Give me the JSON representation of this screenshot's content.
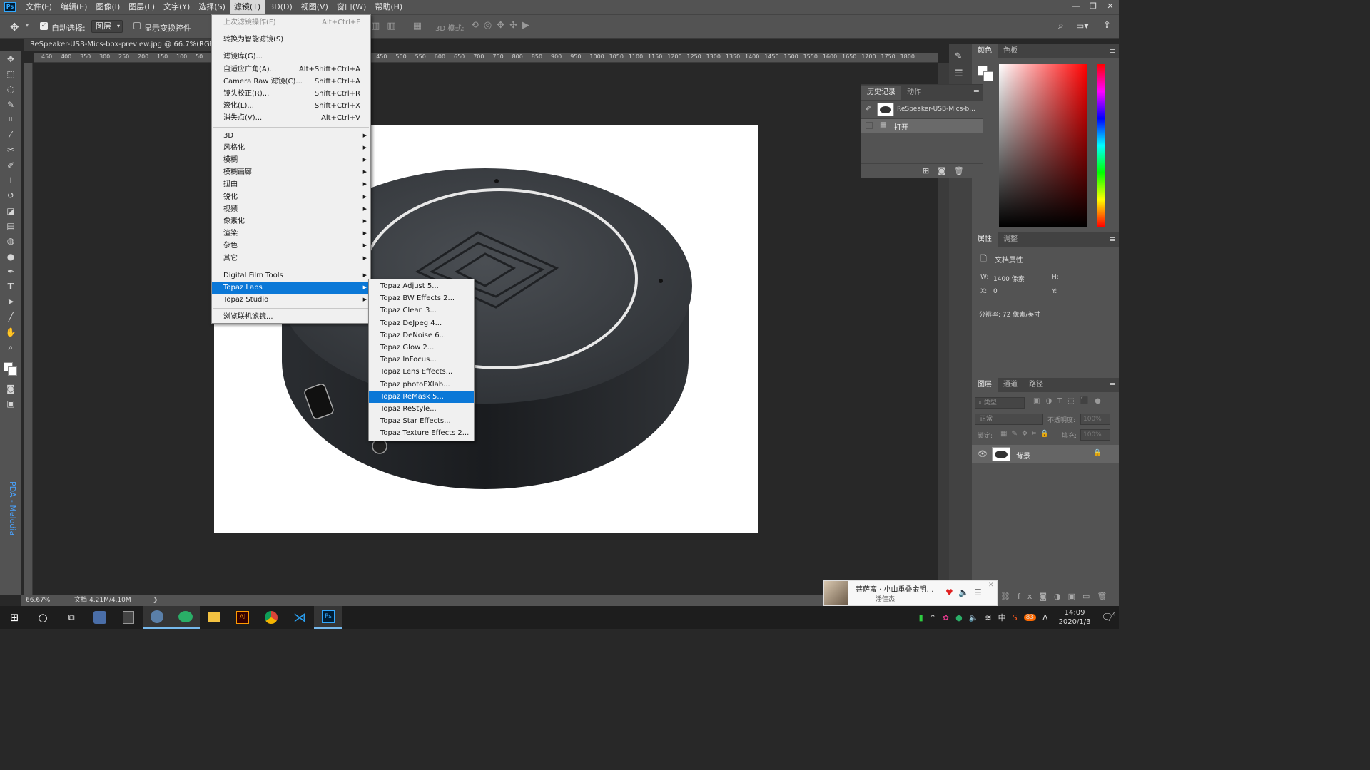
{
  "menubar": {
    "logo": "Ps",
    "items": [
      "文件(F)",
      "编辑(E)",
      "图像(I)",
      "图层(L)",
      "文字(Y)",
      "选择(S)",
      "滤镜(T)",
      "3D(D)",
      "视图(V)",
      "窗口(W)",
      "帮助(H)"
    ],
    "active_index": 6,
    "window_controls": [
      "—",
      "❐",
      "✕"
    ]
  },
  "options": {
    "auto_select_label": "自动选择:",
    "auto_select_checked": true,
    "auto_select_value": "图层",
    "show_transform_label": "显示变换控件",
    "mode_3d_label": "3D 模式:"
  },
  "document": {
    "tab_title": "ReSpeaker-USB-Mics-box-preview.jpg @ 66.7%(RGB/8#)",
    "ruler_ticks_left": [
      "450",
      "400",
      "350",
      "300",
      "250",
      "200",
      "150",
      "100",
      "50"
    ],
    "ruler_ticks_right": [
      "400",
      "450",
      "500",
      "550",
      "600",
      "650",
      "700",
      "750",
      "800",
      "850",
      "900",
      "950",
      "1000",
      "1050",
      "1100",
      "1150",
      "1200",
      "1250",
      "1300",
      "1350",
      "1400",
      "1450",
      "1500",
      "1550",
      "1600",
      "1650",
      "1700",
      "1750",
      "1800"
    ],
    "zoom": "66.67%",
    "doc_size": "文档:4.21M/4.10M",
    "status_arrow": "❯"
  },
  "filter_menu": {
    "items": [
      {
        "label": "上次滤镜操作(F)",
        "shortcut": "Alt+Ctrl+F",
        "disabled": true
      },
      {
        "sep": true
      },
      {
        "label": "转换为智能滤镜(S)"
      },
      {
        "sep": true
      },
      {
        "label": "滤镜库(G)..."
      },
      {
        "label": "自适应广角(A)...",
        "shortcut": "Alt+Shift+Ctrl+A"
      },
      {
        "label": "Camera Raw 滤镜(C)...",
        "shortcut": "Shift+Ctrl+A"
      },
      {
        "label": "镜头校正(R)...",
        "shortcut": "Shift+Ctrl+R"
      },
      {
        "label": "液化(L)...",
        "shortcut": "Shift+Ctrl+X"
      },
      {
        "label": "消失点(V)...",
        "shortcut": "Alt+Ctrl+V"
      },
      {
        "sep": true
      },
      {
        "label": "3D",
        "sub": true
      },
      {
        "label": "风格化",
        "sub": true
      },
      {
        "label": "模糊",
        "sub": true
      },
      {
        "label": "模糊画廊",
        "sub": true
      },
      {
        "label": "扭曲",
        "sub": true
      },
      {
        "label": "锐化",
        "sub": true
      },
      {
        "label": "视频",
        "sub": true
      },
      {
        "label": "像素化",
        "sub": true
      },
      {
        "label": "渲染",
        "sub": true
      },
      {
        "label": "杂色",
        "sub": true
      },
      {
        "label": "其它",
        "sub": true
      },
      {
        "sep": true
      },
      {
        "label": "Digital Film Tools",
        "sub": true
      },
      {
        "label": "Topaz Labs",
        "sub": true,
        "highlight": true
      },
      {
        "label": "Topaz Studio",
        "sub": true
      },
      {
        "sep": true
      },
      {
        "label": "浏览联机滤镜..."
      }
    ]
  },
  "topaz_submenu": {
    "items": [
      "Topaz Adjust 5...",
      "Topaz BW Effects 2...",
      "Topaz Clean 3...",
      "Topaz DeJpeg 4...",
      "Topaz DeNoise 6...",
      "Topaz Glow 2...",
      "Topaz InFocus...",
      "Topaz Lens Effects...",
      "Topaz photoFXlab...",
      "Topaz ReMask 5...",
      "Topaz ReStyle...",
      "Topaz Star Effects...",
      "Topaz Texture Effects 2..."
    ],
    "highlight_index": 9
  },
  "history": {
    "tabs": [
      "历史记录",
      "动作"
    ],
    "snapshot_name": "ReSpeaker-USB-Mics-b...",
    "states": [
      "打开"
    ]
  },
  "color_panel": {
    "tabs": [
      "颜色",
      "色板"
    ]
  },
  "properties": {
    "tabs": [
      "属性",
      "调整"
    ],
    "section": "文档属性",
    "w_label": "W:",
    "w_value": "1400 像素",
    "h_label": "H:",
    "x_label": "X:",
    "x_value": "0",
    "y_label": "Y:",
    "resolution": "分辨率: 72 像素/英寸"
  },
  "layers": {
    "tabs": [
      "图层",
      "通道",
      "路径"
    ],
    "filter_placeholder": "类型",
    "blend_mode": "正常",
    "opacity_label": "不透明度:",
    "opacity_value": "100%",
    "lock_label": "锁定:",
    "fill_label": "填充:",
    "fill_value": "100%",
    "layer_name": "背景"
  },
  "side_text": "PDA - Melodia",
  "music": {
    "title": "菩萨蛮 · 小山重叠金明…",
    "artist": "潘佳杰"
  },
  "taskbar": {
    "time": "14:09",
    "date": "2020/1/3",
    "ime": "中",
    "badge": "83",
    "notification_count": "4"
  },
  "colors": {
    "menu_highlight": "#0b78d7",
    "ps_panel": "#535353",
    "canvas_bg": "#282828"
  }
}
